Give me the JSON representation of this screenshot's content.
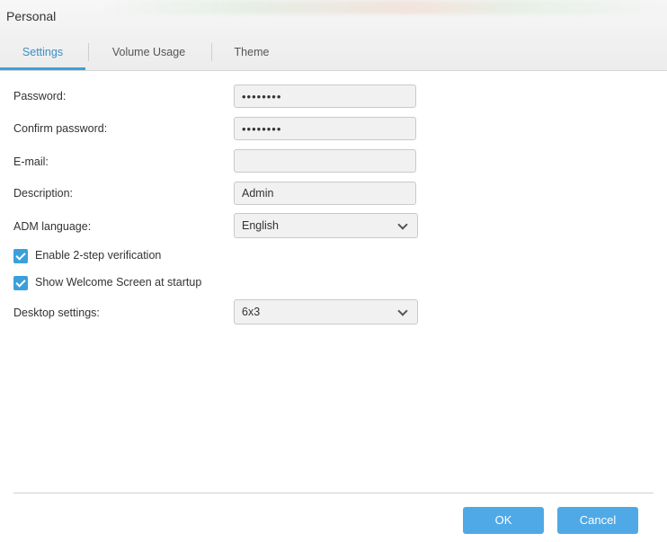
{
  "window": {
    "title": "Personal"
  },
  "tabs": [
    {
      "label": "Settings",
      "active": true
    },
    {
      "label": "Volume Usage",
      "active": false
    },
    {
      "label": "Theme",
      "active": false
    }
  ],
  "form": {
    "password": {
      "label": "Password:",
      "value": "••••••••"
    },
    "confirm_password": {
      "label": "Confirm password:",
      "value": "••••••••"
    },
    "email": {
      "label": "E-mail:",
      "value": ""
    },
    "description": {
      "label": "Description:",
      "value": "Admin"
    },
    "adm_language": {
      "label": "ADM language:",
      "value": "English"
    },
    "two_step": {
      "label": "Enable 2-step verification",
      "checked": true
    },
    "welcome_screen": {
      "label": "Show Welcome Screen at startup",
      "checked": true
    },
    "desktop_settings": {
      "label": "Desktop settings:",
      "value": "6x3"
    }
  },
  "buttons": {
    "ok": "OK",
    "cancel": "Cancel"
  },
  "colors": {
    "accent": "#3aa0dc",
    "button": "#4fa9e6"
  }
}
